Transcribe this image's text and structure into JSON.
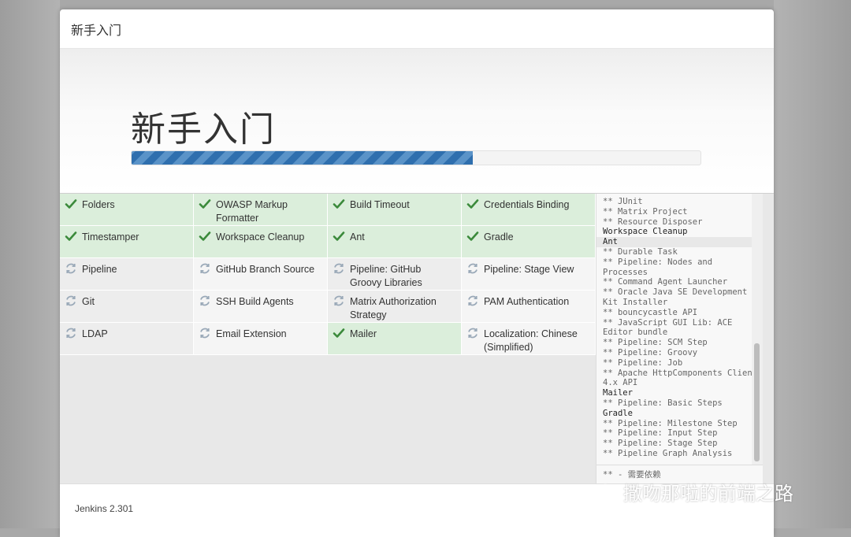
{
  "dialog": {
    "header_title": "新手入门",
    "hero_title": "新手入门",
    "progress_percent": 60
  },
  "plugins": [
    {
      "name": "Folders",
      "status": "success"
    },
    {
      "name": "OWASP Markup Formatter",
      "status": "success"
    },
    {
      "name": "Build Timeout",
      "status": "success"
    },
    {
      "name": "Credentials Binding",
      "status": "success"
    },
    {
      "name": "Timestamper",
      "status": "success"
    },
    {
      "name": "Workspace Cleanup",
      "status": "success"
    },
    {
      "name": "Ant",
      "status": "success"
    },
    {
      "name": "Gradle",
      "status": "success"
    },
    {
      "name": "Pipeline",
      "status": "pending"
    },
    {
      "name": "GitHub Branch Source",
      "status": "pending"
    },
    {
      "name": "Pipeline: GitHub Groovy Libraries",
      "status": "pending"
    },
    {
      "name": "Pipeline: Stage View",
      "status": "pending"
    },
    {
      "name": "Git",
      "status": "pending"
    },
    {
      "name": "SSH Build Agents",
      "status": "pending"
    },
    {
      "name": "Matrix Authorization Strategy",
      "status": "pending"
    },
    {
      "name": "PAM Authentication",
      "status": "pending"
    },
    {
      "name": "LDAP",
      "status": "pending"
    },
    {
      "name": "Email Extension",
      "status": "pending"
    },
    {
      "name": "Mailer",
      "status": "success"
    },
    {
      "name": "Localization: Chinese (Simplified)",
      "status": "pending"
    }
  ],
  "install_log": [
    {
      "text": "** JUnit",
      "type": "dep"
    },
    {
      "text": "** Matrix Project",
      "type": "dep"
    },
    {
      "text": "** Resource Disposer",
      "type": "dep"
    },
    {
      "text": "Workspace Cleanup",
      "type": "plugin"
    },
    {
      "text": "Ant",
      "type": "plugin",
      "highlight": true
    },
    {
      "text": "** Durable Task",
      "type": "dep"
    },
    {
      "text": "** Pipeline: Nodes and Processes",
      "type": "dep"
    },
    {
      "text": "** Command Agent Launcher",
      "type": "dep"
    },
    {
      "text": "** Oracle Java SE Development Kit Installer",
      "type": "dep"
    },
    {
      "text": "** bouncycastle API",
      "type": "dep"
    },
    {
      "text": "** JavaScript GUI Lib: ACE Editor bundle",
      "type": "dep"
    },
    {
      "text": "** Pipeline: SCM Step",
      "type": "dep"
    },
    {
      "text": "** Pipeline: Groovy",
      "type": "dep"
    },
    {
      "text": "** Pipeline: Job",
      "type": "dep"
    },
    {
      "text": "** Apache HttpComponents Client 4.x API",
      "type": "dep"
    },
    {
      "text": "Mailer",
      "type": "plugin"
    },
    {
      "text": "** Pipeline: Basic Steps",
      "type": "dep"
    },
    {
      "text": "Gradle",
      "type": "plugin"
    },
    {
      "text": "** Pipeline: Milestone Step",
      "type": "dep"
    },
    {
      "text": "** Pipeline: Input Step",
      "type": "dep"
    },
    {
      "text": "** Pipeline: Stage Step",
      "type": "dep"
    },
    {
      "text": "** Pipeline Graph Analysis",
      "type": "dep"
    }
  ],
  "log_legend": "** - 需要依赖",
  "footer": {
    "version": "Jenkins 2.301"
  },
  "watermark": {
    "text": "撒吻那啦的前端之路"
  },
  "colors": {
    "success": "#3b8a3b",
    "pending": "#9aa9b8",
    "progress": "#2f6fae"
  }
}
